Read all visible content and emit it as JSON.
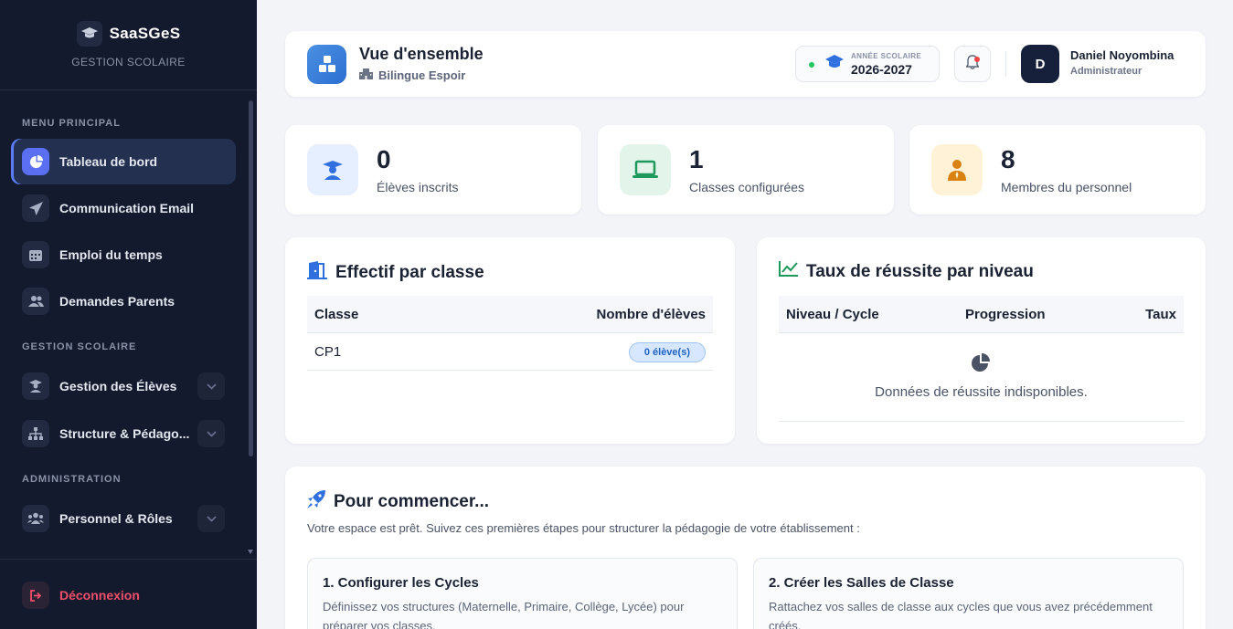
{
  "sidebar": {
    "brand_name": "SaaSGeS",
    "brand_sub": "GESTION SCOLAIRE",
    "sections": {
      "main": "MENU PRINCIPAL",
      "school": "GESTION SCOLAIRE",
      "admin": "ADMINISTRATION"
    },
    "items": [
      {
        "label": "Tableau de bord",
        "icon": "pie-chart-icon",
        "active": true
      },
      {
        "label": "Communication Email",
        "icon": "paper-plane-icon"
      },
      {
        "label": "Emploi du temps",
        "icon": "calendar-icon"
      },
      {
        "label": "Demandes Parents",
        "icon": "users-icon"
      },
      {
        "label": "Gestion des Élèves",
        "icon": "student-icon",
        "expandable": true
      },
      {
        "label": "Structure & Pédago...",
        "icon": "sitemap-icon",
        "expandable": true
      },
      {
        "label": "Personnel & Rôles",
        "icon": "staff-icon",
        "expandable": true
      }
    ],
    "logout_label": "Déconnexion"
  },
  "header": {
    "title": "Vue d'ensemble",
    "subtitle": "Bilingue Espoir",
    "year_label": "ANNÉE SCOLAIRE",
    "year_value": "2026-2027",
    "user_initial": "D",
    "user_name": "Daniel Noyombina",
    "user_role": "Administrateur"
  },
  "stats": [
    {
      "value": "0",
      "label": "Élèves inscrits",
      "icon": "student-icon",
      "color": "#2f6fde",
      "bg": "#e6efff"
    },
    {
      "value": "1",
      "label": "Classes configurées",
      "icon": "laptop-icon",
      "color": "#1d9a5b",
      "bg": "#e3f4ea"
    },
    {
      "value": "8",
      "label": "Membres du personnel",
      "icon": "person-tie-icon",
      "color": "#d98211",
      "bg": "#fff2d6"
    }
  ],
  "effectif": {
    "title": "Effectif par classe",
    "col_class": "Classe",
    "col_count": "Nombre d'élèves",
    "rows": [
      {
        "classe": "CP1",
        "count": "0 élève(s)"
      }
    ]
  },
  "reussite": {
    "title": "Taux de réussite par niveau",
    "col_level": "Niveau / Cycle",
    "col_progress": "Progression",
    "col_rate": "Taux",
    "empty_text": "Données de réussite indisponibles."
  },
  "start": {
    "title": "Pour commencer...",
    "desc": "Votre espace est prêt. Suivez ces premières étapes pour structurer la pédagogie de votre établissement :",
    "steps": [
      {
        "title": "1. Configurer les Cycles",
        "desc": "Définissez vos structures (Maternelle, Primaire, Collège, Lycée) pour préparer vos classes."
      },
      {
        "title": "2. Créer les Salles de Classe",
        "desc": "Rattachez vos salles de classe aux cycles que vous avez précédemment créés."
      }
    ]
  }
}
